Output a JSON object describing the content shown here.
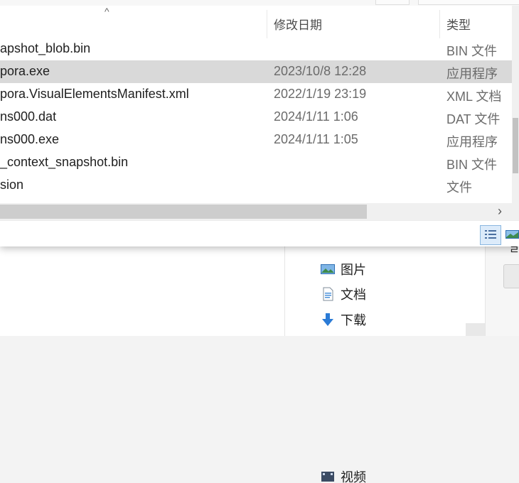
{
  "columns": {
    "date": "修改日期",
    "type": "类型"
  },
  "files": [
    {
      "name": "apshot_blob.bin",
      "date": "",
      "type": "BIN 文件",
      "selected": false
    },
    {
      "name": "pora.exe",
      "date": "2023/10/8 12:28",
      "type": "应用程序",
      "selected": true
    },
    {
      "name": "pora.VisualElementsManifest.xml",
      "date": "2022/1/19 23:19",
      "type": "XML 文档",
      "selected": false
    },
    {
      "name": "ns000.dat",
      "date": "2024/1/11 1:06",
      "type": "DAT 文件",
      "selected": false
    },
    {
      "name": "ns000.exe",
      "date": "2024/1/11 1:05",
      "type": "应用程序",
      "selected": false
    },
    {
      "name": "_context_snapshot.bin",
      "date": "",
      "type": "BIN 文件",
      "selected": false
    },
    {
      "name": "sion",
      "date": "",
      "type": "文件",
      "selected": false
    }
  ],
  "nav": {
    "partial": "视频",
    "pictures": "图片",
    "documents": "文档",
    "downloads": "下载"
  }
}
